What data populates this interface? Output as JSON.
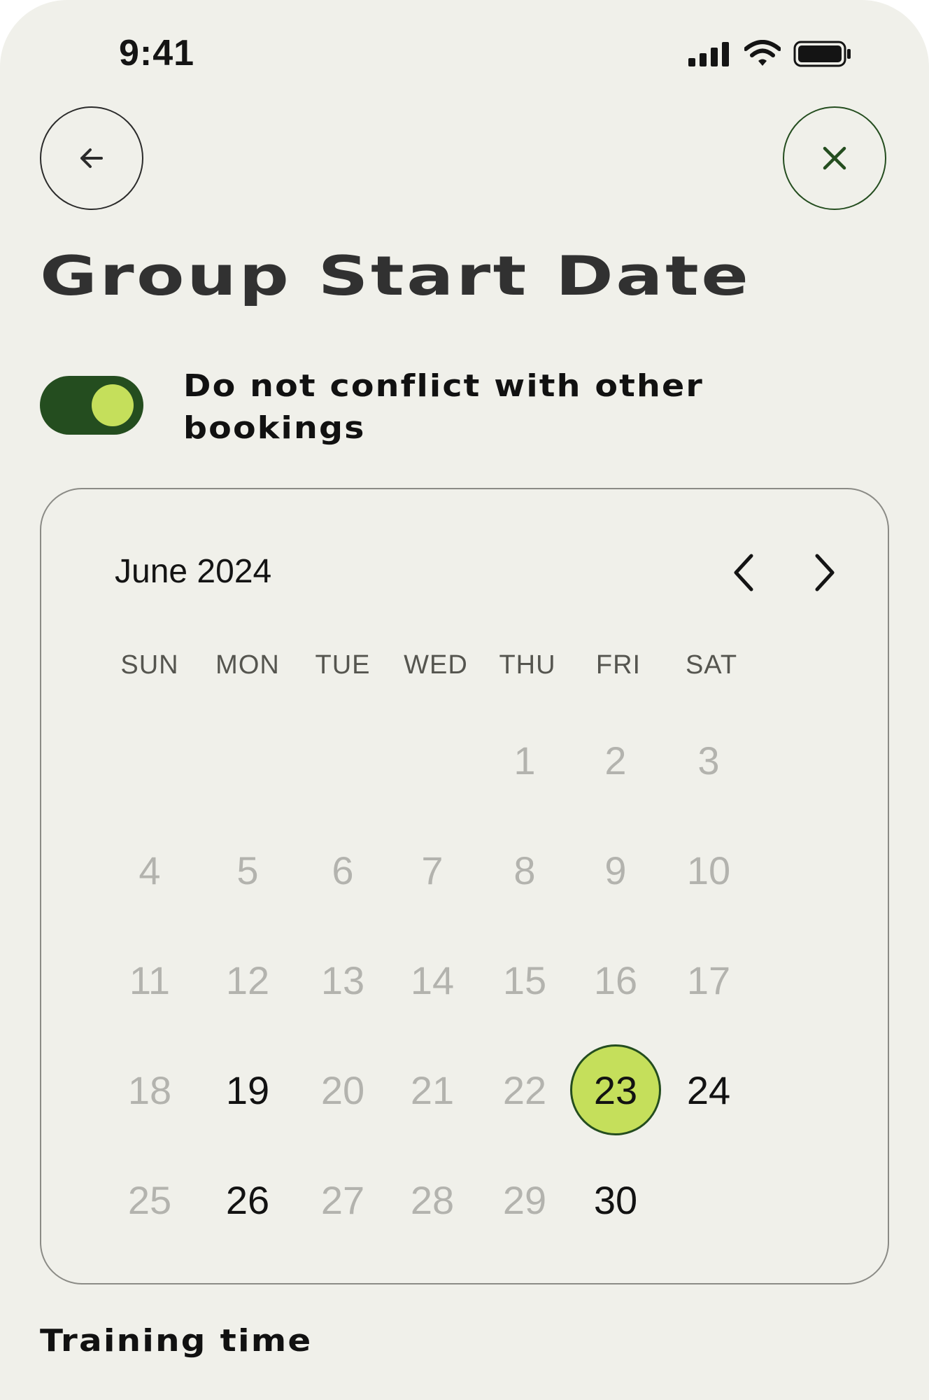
{
  "status_bar": {
    "time": "9:41",
    "icons": [
      "signal-icon",
      "wifi-icon",
      "battery-icon"
    ]
  },
  "nav": {
    "back_icon": "arrow-left-icon",
    "close_icon": "close-icon"
  },
  "title": "Group Start Date",
  "toggle": {
    "label": "Do not conflict with other bookings",
    "on": true
  },
  "calendar": {
    "month_label": "June 2024",
    "prev_icon": "chevron-left-icon",
    "next_icon": "chevron-right-icon",
    "weekdays": [
      "SUN",
      "MON",
      "TUE",
      "WED",
      "THU",
      "FRI",
      "SAT"
    ],
    "first_weekday_index": 4,
    "days": [
      {
        "label": "1",
        "state": "disabled"
      },
      {
        "label": "2",
        "state": "disabled"
      },
      {
        "label": "3",
        "state": "disabled"
      },
      {
        "label": "4",
        "state": "disabled"
      },
      {
        "label": "5",
        "state": "disabled"
      },
      {
        "label": "6",
        "state": "disabled"
      },
      {
        "label": "7",
        "state": "disabled"
      },
      {
        "label": "8",
        "state": "disabled"
      },
      {
        "label": "9",
        "state": "disabled"
      },
      {
        "label": "10",
        "state": "disabled"
      },
      {
        "label": "11",
        "state": "disabled"
      },
      {
        "label": "12",
        "state": "disabled"
      },
      {
        "label": "13",
        "state": "disabled"
      },
      {
        "label": "14",
        "state": "disabled"
      },
      {
        "label": "15",
        "state": "disabled"
      },
      {
        "label": "16",
        "state": "disabled"
      },
      {
        "label": "17",
        "state": "disabled"
      },
      {
        "label": "18",
        "state": "disabled"
      },
      {
        "label": "19",
        "state": "available"
      },
      {
        "label": "20",
        "state": "disabled"
      },
      {
        "label": "21",
        "state": "disabled"
      },
      {
        "label": "22",
        "state": "disabled"
      },
      {
        "label": "23",
        "state": "selected"
      },
      {
        "label": "24",
        "state": "available"
      },
      {
        "label": "25",
        "state": "disabled"
      },
      {
        "label": "26",
        "state": "available"
      },
      {
        "label": "27",
        "state": "disabled"
      },
      {
        "label": "28",
        "state": "disabled"
      },
      {
        "label": "29",
        "state": "disabled"
      },
      {
        "label": "30",
        "state": "available"
      }
    ]
  },
  "section_title": "Training time",
  "colors": {
    "background": "#f0f0ea",
    "accent_dark": "#244d1f",
    "accent_light": "#c5df5b",
    "text_primary": "#121212",
    "text_disabled": "#b3b3ae"
  }
}
